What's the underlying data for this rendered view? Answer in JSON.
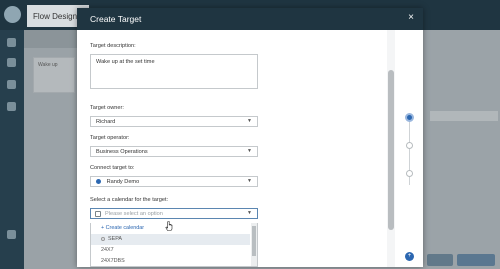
{
  "background": {
    "tab_label": "Flow Designer",
    "card_label": "Wake up"
  },
  "modal": {
    "title": "Create Target",
    "close_glyph": "×"
  },
  "form": {
    "description_label": "Target description:",
    "description_value": "Wake up at the set time",
    "owner_label": "Target owner:",
    "owner_value": "Richard",
    "operator_label": "Target operator:",
    "operator_value": "Business Operations",
    "connect_label": "Connect target to:",
    "connect_value": "Randy Demo",
    "calendar_label": "Select a calendar for the target:",
    "calendar_placeholder": "Please select an option"
  },
  "calendar_options": {
    "create": "+ Create calendar",
    "items": [
      "SEPA",
      "24X7",
      "24X7DBS"
    ]
  },
  "icons": {
    "close": "close-icon",
    "chevron": "chevron-down-icon",
    "connect": "link-dot-icon",
    "help": "help-icon"
  },
  "colors": {
    "header": "#1f3541",
    "accent": "#2c67b1"
  }
}
